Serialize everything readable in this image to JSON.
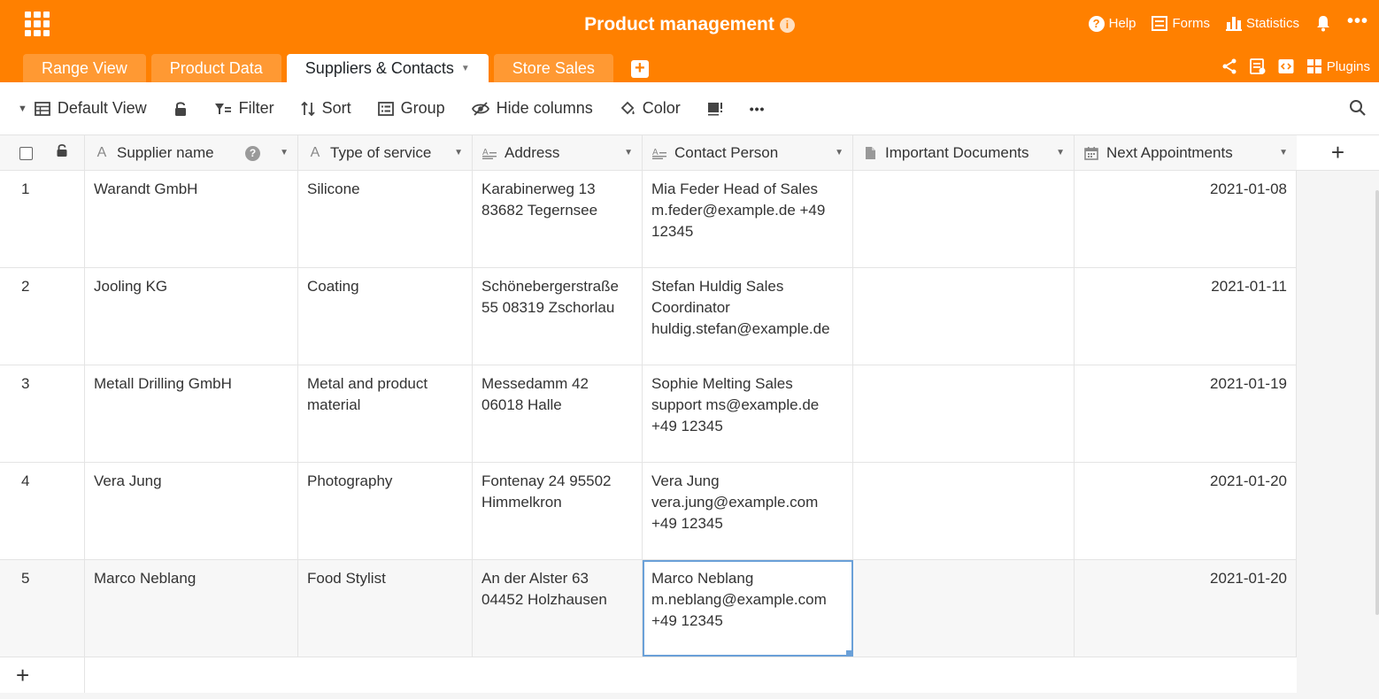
{
  "app": {
    "title": "Product management",
    "info_glyph": "i",
    "help_label": "Help",
    "forms_label": "Forms",
    "statistics_label": "Statistics",
    "plugins_label": "Plugins",
    "more_glyph": "•••",
    "brand_color": "#ff8000"
  },
  "tabs": [
    {
      "label": "Range View",
      "active": false
    },
    {
      "label": "Product Data",
      "active": false
    },
    {
      "label": "Suppliers & Contacts",
      "active": true
    },
    {
      "label": "Store Sales",
      "active": false
    }
  ],
  "toolbar": {
    "view_label": "Default View",
    "filter_label": "Filter",
    "sort_label": "Sort",
    "group_label": "Group",
    "hide_columns_label": "Hide columns",
    "color_label": "Color",
    "more_glyph": "•••"
  },
  "columns": [
    {
      "label": "Supplier name",
      "icon": "text-icon"
    },
    {
      "label": "Type of service",
      "icon": "text-icon"
    },
    {
      "label": "Address",
      "icon": "long-text-icon"
    },
    {
      "label": "Contact Person",
      "icon": "long-text-icon"
    },
    {
      "label": "Important Documents",
      "icon": "file-icon"
    },
    {
      "label": "Next Appointments",
      "icon": "calendar-icon"
    }
  ],
  "rows": [
    {
      "idx": "1",
      "supplier": "Warandt GmbH",
      "type": "Silicone",
      "address": "Karabinerweg 13 83682 Tegernsee",
      "contact": "Mia Feder Head of Sales m.feder@example.de +49 12345",
      "documents": "",
      "appointment": "2021-01-08"
    },
    {
      "idx": "2",
      "supplier": "Jooling KG",
      "type": "Coating",
      "address": "Schönebergerstraße 55 08319 Zschorlau",
      "contact": "Stefan Huldig Sales Coordinator huldig.stefan@example.de",
      "documents": "",
      "appointment": "2021-01-11"
    },
    {
      "idx": "3",
      "supplier": "Metall Drilling GmbH",
      "type": "Metal and product material",
      "address": "Messedamm 42 06018 Halle",
      "contact": "Sophie Melting Sales support ms@example.de +49 12345",
      "documents": "",
      "appointment": "2021-01-19"
    },
    {
      "idx": "4",
      "supplier": "Vera Jung",
      "type": "Photography",
      "address": "Fontenay 24 95502 Himmelkron",
      "contact": "Vera Jung vera.jung@example.com +49 12345",
      "documents": "",
      "appointment": "2021-01-20"
    },
    {
      "idx": "5",
      "supplier": "Marco Neblang",
      "type": "Food Stylist",
      "address": "An der Alster 63 04452 Holzhausen",
      "contact": "Marco Neblang m.neblang@example.com +49 12345",
      "documents": "",
      "appointment": "2021-01-20"
    }
  ],
  "grid": {
    "add_glyph": "+",
    "question_glyph": "?"
  }
}
